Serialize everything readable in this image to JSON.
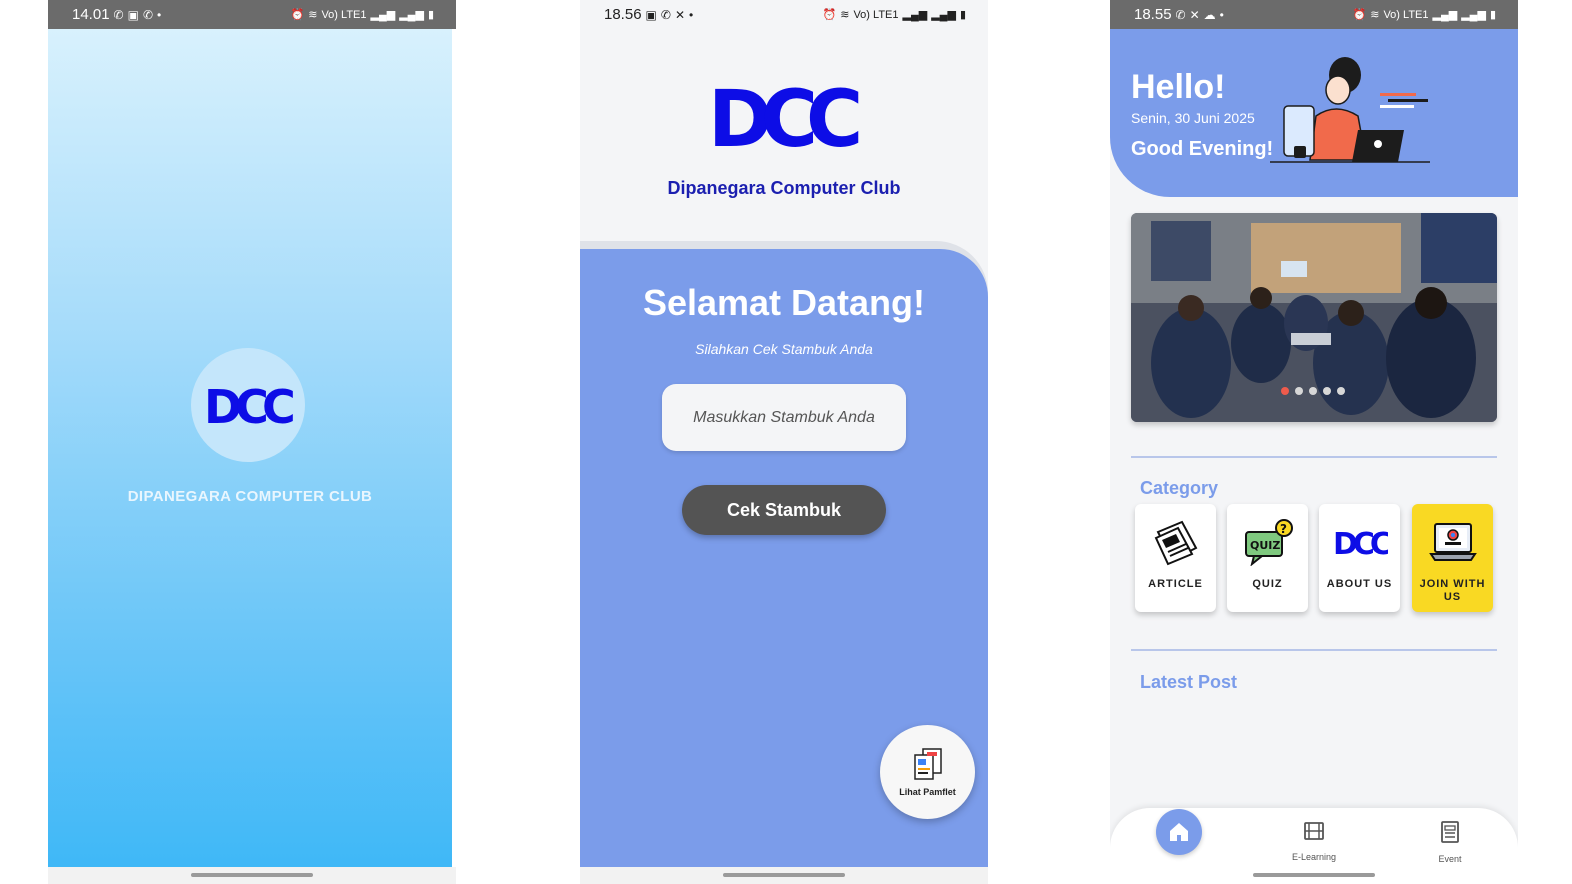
{
  "screen1": {
    "status": {
      "time": "14.01",
      "net": "Vo) LTE1"
    },
    "logo_text": "DCC",
    "caption": "DIPANEGARA COMPUTER CLUB"
  },
  "screen2": {
    "status": {
      "time": "18.56",
      "net": "Vo) LTE1"
    },
    "logo_text": "DCC",
    "club_name": "Dipanegara Computer Club",
    "welcome": "Selamat Datang!",
    "subtitle": "Silahkan Cek Stambuk Anda",
    "input_placeholder": "Masukkan Stambuk Anda",
    "check_button": "Cek Stambuk",
    "fab_label": "Lihat Pamflet"
  },
  "screen3": {
    "status": {
      "time": "18.55",
      "net": "Vo) LTE1"
    },
    "greeting": "Hello!",
    "date": "Senin, 30 Juni 2025",
    "time_greeting": "Good Evening!",
    "carousel": {
      "slides": 5,
      "active": 0
    },
    "category_title": "Category",
    "categories": [
      {
        "label": "ARTICLE",
        "icon": "news-icon"
      },
      {
        "label": "QUIZ",
        "icon": "quiz-icon"
      },
      {
        "label": "ABOUT US",
        "icon": "dcc-logo-icon"
      },
      {
        "label": "JOIN WITH US",
        "icon": "join-icon"
      }
    ],
    "latest_title": "Latest Post",
    "nav": [
      {
        "label": "Home",
        "icon": "home-icon"
      },
      {
        "label": "E-Learning",
        "icon": "film-icon"
      },
      {
        "label": "Event",
        "icon": "document-icon"
      }
    ]
  },
  "colors": {
    "primary": "#7b9cea",
    "logo_blue": "#0d0de6",
    "join_yellow": "#f9d923",
    "dot_active": "#ee5b4c",
    "button_dark": "#545454"
  }
}
